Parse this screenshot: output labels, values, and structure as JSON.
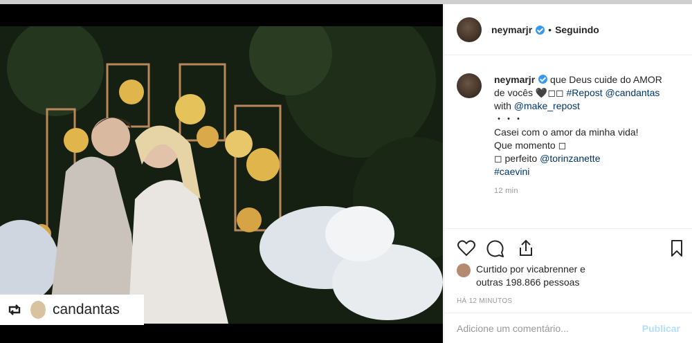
{
  "post": {
    "username": "neymarjr",
    "separator": "•",
    "follow_status": "Seguindo",
    "caption": {
      "username": "neymarjr",
      "line1": "que Deus cuide do AMOR",
      "line2_prefix": "de vocês 🖤◻◻ ",
      "hashtag_repost": "#Repost",
      "mention_candantas": "@candantas",
      "line3_prefix": "with ",
      "mention_make_repost": "@make_repost",
      "dots": "・・・",
      "line5": "Casei com o amor da minha vida!",
      "line6": "Que momento ◻",
      "line7_prefix": "◻ perfeito ",
      "mention_torinzanette": "@torinzanette",
      "hashtag_caevini": "#caevini"
    },
    "caption_time": "12 min",
    "likes": {
      "line1": "Curtido por vicabrenner e",
      "line2": "outras 198.866 pessoas"
    },
    "posted_ago": "HÁ 12 MINUTOS",
    "comment_placeholder": "Adicione um comentário...",
    "publish_label": "Publicar"
  },
  "media": {
    "repost_username": "candantas"
  },
  "icons": {
    "like": "heart-icon",
    "comment": "comment-icon",
    "share": "share-icon",
    "save": "bookmark-icon",
    "repost": "repost-icon"
  },
  "colors": {
    "verified": "#3897f0",
    "link": "#003569",
    "publish_disabled": "#b2dffc"
  }
}
